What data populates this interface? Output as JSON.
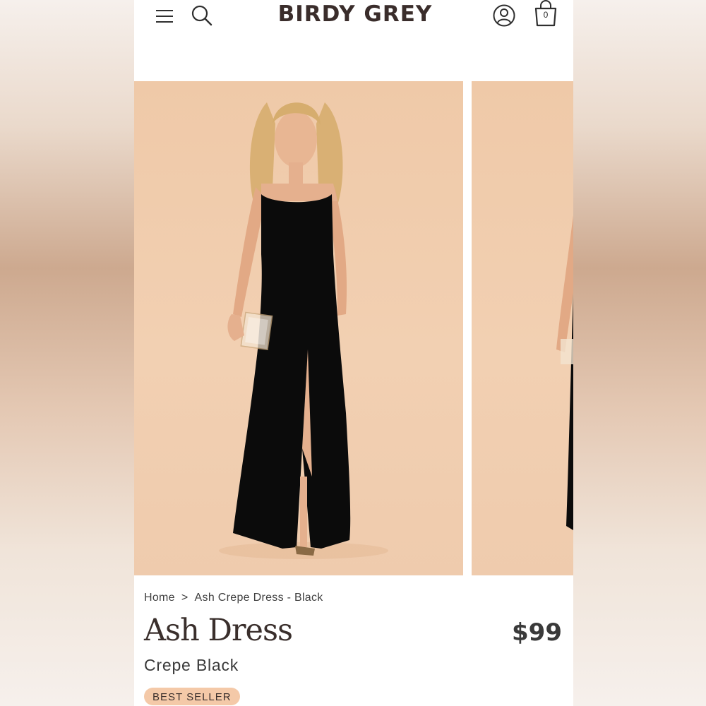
{
  "header": {
    "logo": "BIRDY GREY",
    "menu_icon": "hamburger-menu-icon",
    "search_icon": "search-icon",
    "account_icon": "user-account-icon",
    "cart_icon": "shopping-bag-icon",
    "cart_count": "0"
  },
  "gallery": {
    "background_color": "#f0cbab",
    "dress_color": "#0b0b0b"
  },
  "breadcrumb": {
    "home": "Home",
    "separator": ">",
    "current": "Ash Crepe Dress - Black"
  },
  "product": {
    "title": "Ash Dress",
    "price": "$99",
    "variant": "Crepe Black",
    "badge": "BEST SELLER",
    "badge_color": "#f4c9a8"
  }
}
